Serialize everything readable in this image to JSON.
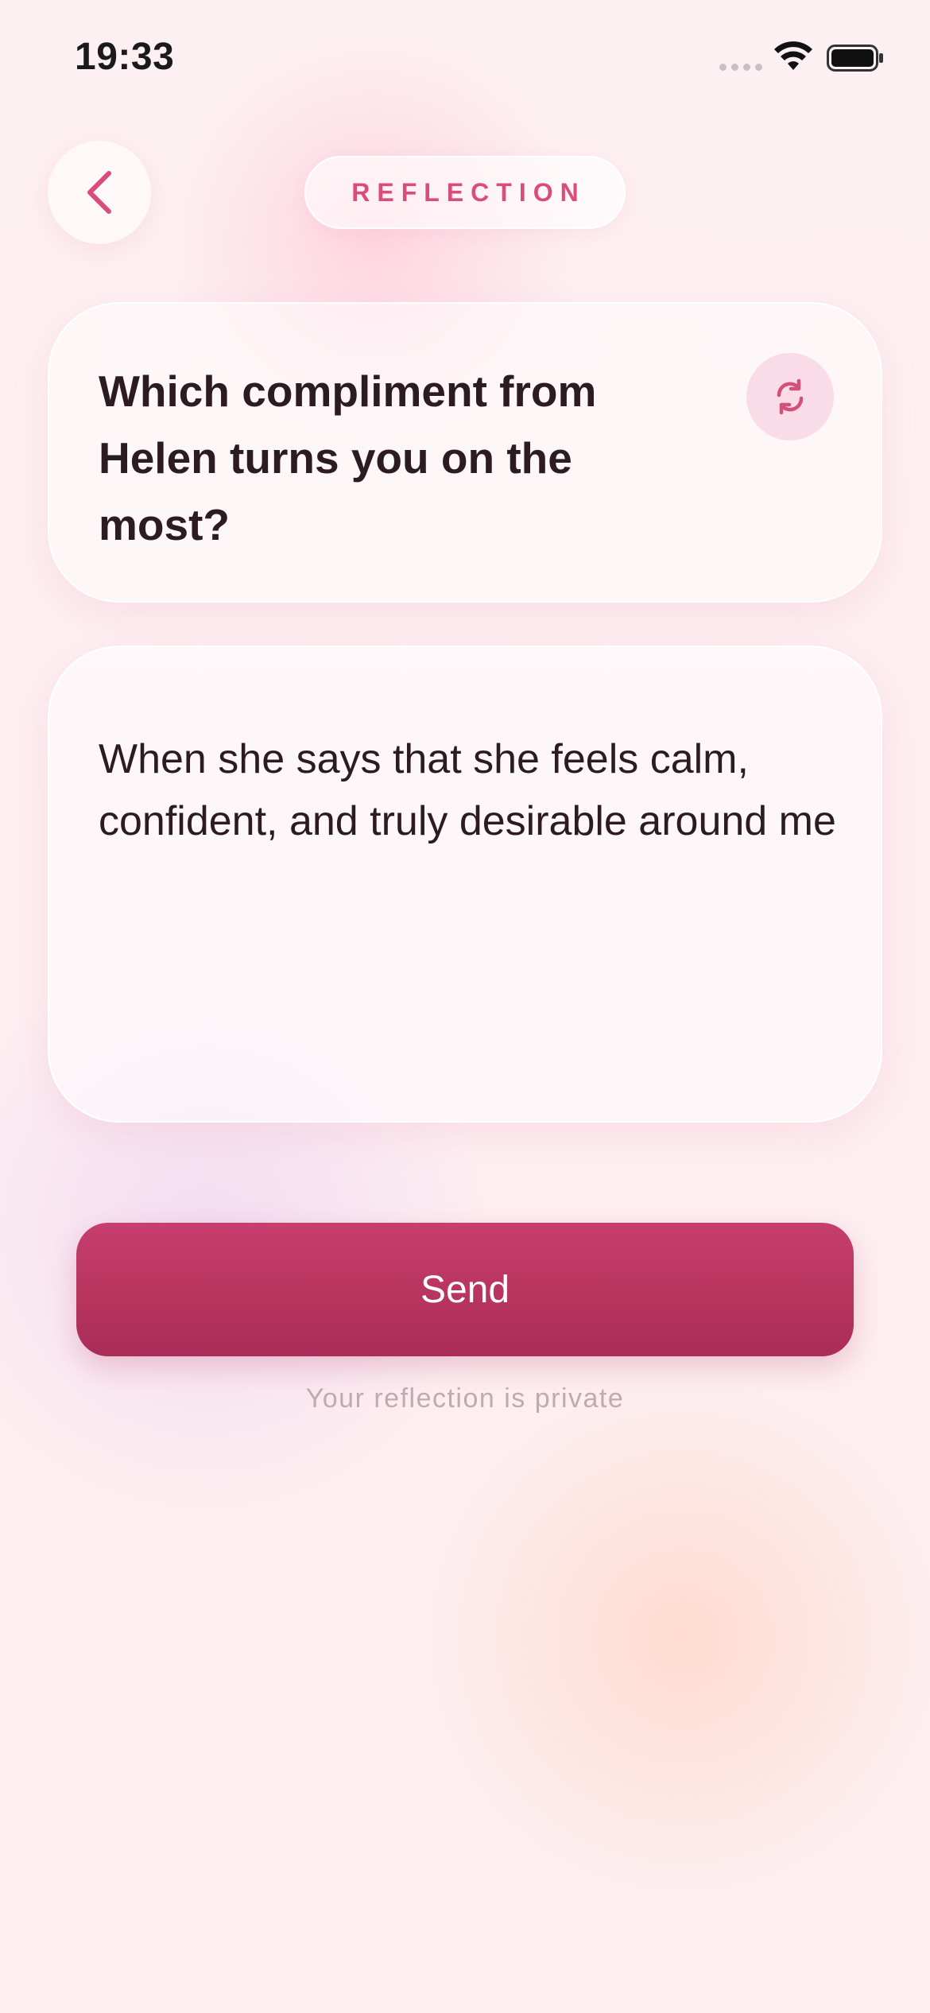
{
  "status_bar": {
    "time": "19:33"
  },
  "header": {
    "title": "REFLECTION",
    "back_icon": "chevron-left-icon"
  },
  "question_card": {
    "question": "Which compliment from Helen turns you on the most?",
    "refresh_icon": "refresh-icon"
  },
  "answer_card": {
    "text": "When she says that she feels calm, confident, and truly desirable around me"
  },
  "send_button": {
    "label": "Send"
  },
  "footer": {
    "note": "Your reflection is private"
  },
  "colors": {
    "accent": "#d94d7a",
    "button": "#b8355f",
    "text": "#2c1b22",
    "muted": "#c2a9b0"
  }
}
